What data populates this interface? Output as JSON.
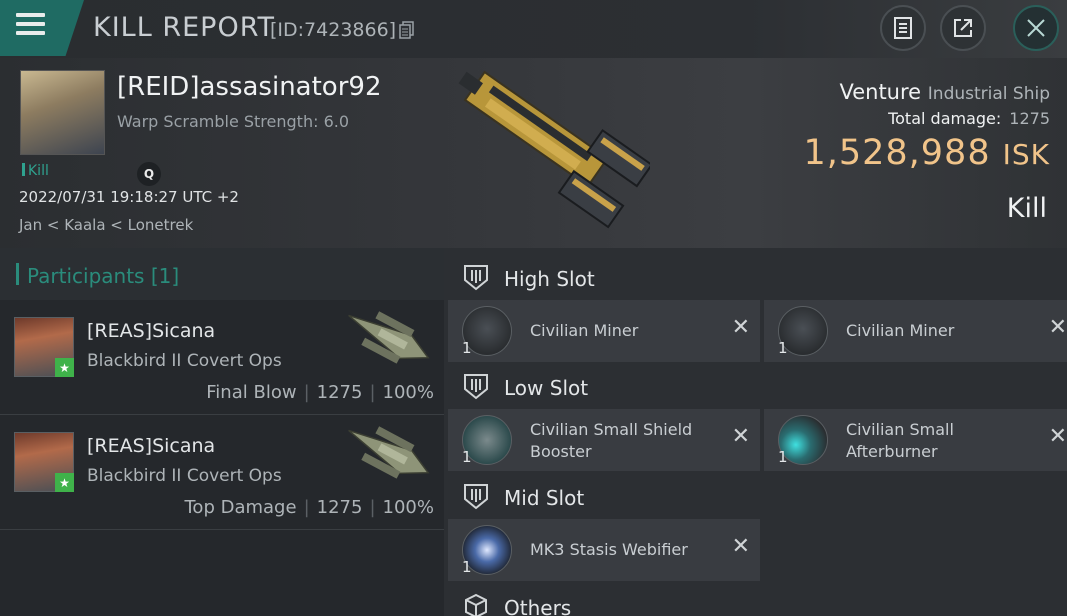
{
  "header": {
    "title": "KILL REPORT",
    "report_id": "[ID:7423866]"
  },
  "victim": {
    "name": "[REID]assasinator92",
    "warp_scramble": "Warp Scramble Strength: 6.0",
    "kill_tag": "Kill",
    "badge": "Q",
    "datetime": "2022/07/31 19:18:27 UTC +2",
    "location": "Jan < Kaala < Lonetrek",
    "ship_name": "Venture",
    "ship_class": "Industrial Ship",
    "total_damage_label": "Total damage:",
    "total_damage": "1275",
    "isk_value": "1,528,988",
    "isk_unit": "ISK",
    "result": "Kill"
  },
  "participants": {
    "heading": "Participants [1]",
    "list": [
      {
        "name": "[REAS]Sicana",
        "ship": "Blackbird II Covert Ops",
        "role": "Final Blow",
        "damage": "1275",
        "percent": "100%"
      },
      {
        "name": "[REAS]Sicana",
        "ship": "Blackbird II Covert Ops",
        "role": "Top Damage",
        "damage": "1275",
        "percent": "100%"
      }
    ]
  },
  "fitting": {
    "high_slot": "High Slot",
    "low_slot": "Low Slot",
    "mid_slot": "Mid Slot",
    "others": "Others",
    "high": [
      {
        "qty": "1",
        "name": "Civilian Miner"
      },
      {
        "qty": "1",
        "name": "Civilian Miner"
      }
    ],
    "low": [
      {
        "qty": "1",
        "name": "Civilian Small Shield Booster"
      },
      {
        "qty": "1",
        "name": "Civilian Small Afterburner"
      }
    ],
    "mid": [
      {
        "qty": "1",
        "name": "MK3 Stasis Webifier"
      }
    ]
  },
  "colors": {
    "accent": "#2a8c7c",
    "isk": "#f1c48a",
    "menu": "#1f6b63"
  }
}
